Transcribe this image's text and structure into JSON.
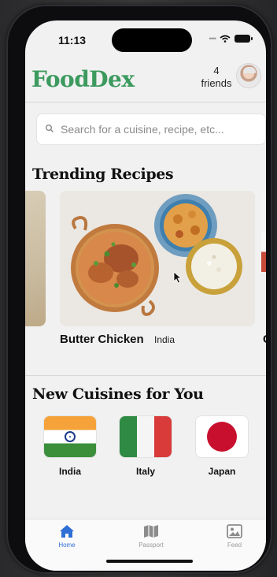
{
  "status_bar": {
    "time": "11:13"
  },
  "header": {
    "logo": "FoodDex",
    "friends_count": "4",
    "friends_label": "friends"
  },
  "search": {
    "placeholder": "Search for a cuisine, recipe, etc..."
  },
  "trending": {
    "title": "Trending Recipes",
    "recipes": [
      {
        "name": "Butter Chicken",
        "origin": "India"
      },
      {
        "name": "C"
      }
    ]
  },
  "new_cuisines": {
    "title": "New Cuisines for You",
    "items": [
      {
        "name": "India"
      },
      {
        "name": "Italy"
      },
      {
        "name": "Japan"
      }
    ]
  },
  "tabbar": {
    "tabs": [
      {
        "label": "Home",
        "icon": "home-icon",
        "active": true
      },
      {
        "label": "Passport",
        "icon": "map-icon",
        "active": false
      },
      {
        "label": "Feed",
        "icon": "image-icon",
        "active": false
      }
    ]
  },
  "colors": {
    "brand_green": "#3d9a5f",
    "active_tab_blue": "#2f6fd6"
  }
}
